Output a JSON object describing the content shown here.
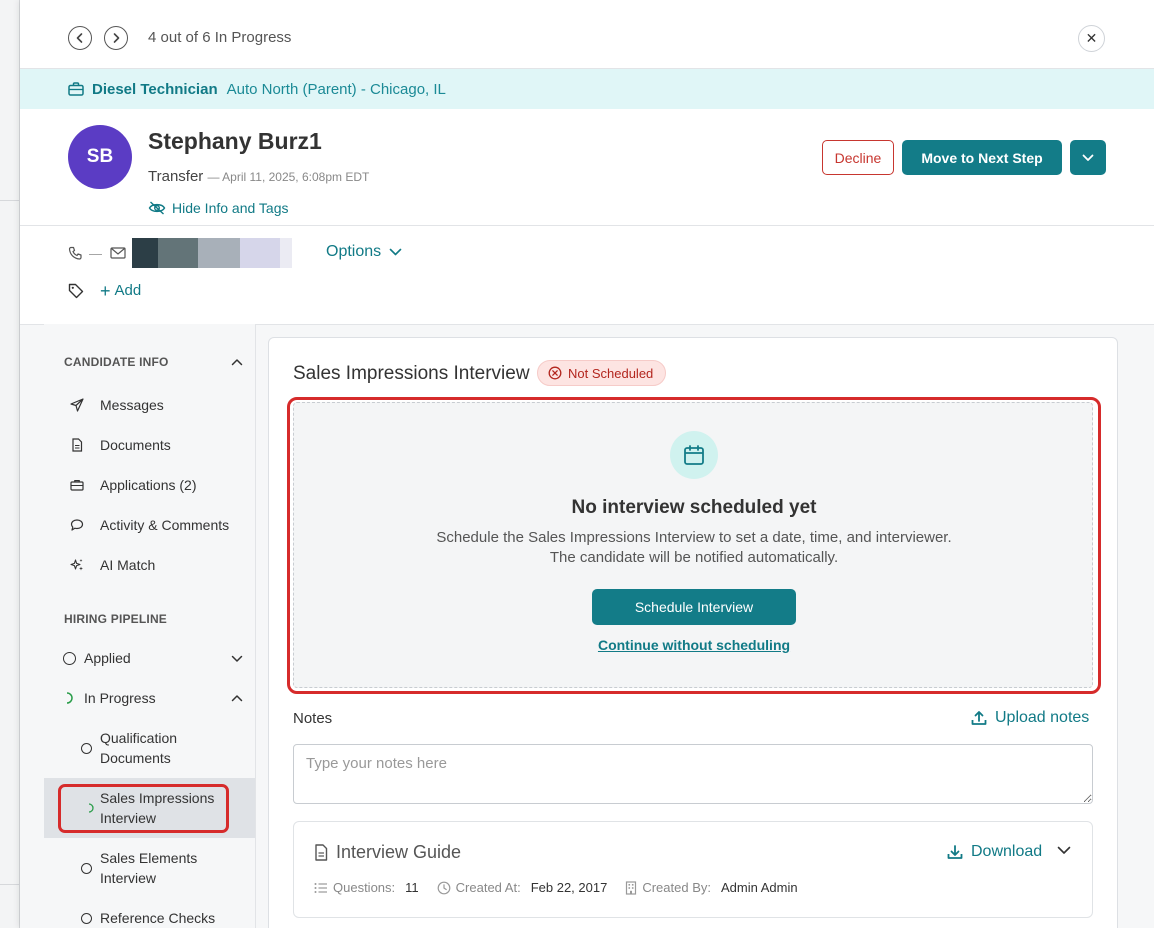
{
  "header": {
    "counter_text": "4 out of 6 In Progress",
    "close_label": "✕"
  },
  "job": {
    "title": "Diesel Technician",
    "location": "Auto North (Parent) - Chicago, IL"
  },
  "candidate": {
    "initials": "SB",
    "name": "Stephany Burz1",
    "source": "Transfer",
    "date_text": "— April 11, 2025, 6:08pm EDT",
    "hide_info_label": "Hide Info and Tags",
    "phone_value": "—",
    "options_label": "Options",
    "add_tag_label": "Add",
    "avatar_color": "#5b3cc4"
  },
  "actions": {
    "decline_label": "Decline",
    "next_step_label": "Move to Next Step"
  },
  "sidebar": {
    "candidate_info_heading": "CANDIDATE INFO",
    "candidate_info_items": [
      {
        "label": "Messages",
        "icon": "paper-plane-icon"
      },
      {
        "label": "Documents",
        "icon": "document-icon"
      },
      {
        "label": "Applications (2)",
        "icon": "briefcase-icon"
      },
      {
        "label": "Activity & Comments",
        "icon": "chat-bubble-icon"
      },
      {
        "label": "AI Match",
        "icon": "sparkle-icon"
      }
    ],
    "hiring_pipeline_heading": "HIRING PIPELINE",
    "pipeline": {
      "applied": "Applied",
      "in_progress": "In Progress",
      "steps": [
        {
          "label": "Qualification Documents",
          "status": "not-started"
        },
        {
          "label": "Sales Impressions Interview",
          "status": "in-progress",
          "selected": true
        },
        {
          "label": "Sales Elements Interview",
          "status": "not-started"
        },
        {
          "label": "Reference Checks",
          "status": "not-started"
        }
      ]
    }
  },
  "main": {
    "interview_title": "Sales Impressions Interview",
    "status_badge": "Not Scheduled",
    "empty_state": {
      "title": "No interview scheduled yet",
      "desc_line1": "Schedule the Sales Impressions Interview to set a date, time, and interviewer.",
      "desc_line2": "The candidate will be notified automatically.",
      "schedule_button": "Schedule Interview",
      "continue_link": "Continue without scheduling"
    },
    "notes": {
      "label": "Notes",
      "upload_label": "Upload notes",
      "placeholder": "Type your notes here",
      "value": ""
    },
    "guide": {
      "title": "Interview Guide",
      "download_label": "Download",
      "questions_label": "Questions:",
      "questions_value": "11",
      "created_at_label": "Created At:",
      "created_at_value": "Feb 22, 2017",
      "created_by_label": "Created By:",
      "created_by_value": "Admin Admin"
    }
  },
  "colors": {
    "brand_teal": "#137c88",
    "decline_red": "#c7362f",
    "job_bar_bg": "#e0f6f7",
    "badge_bg": "#fde4e2"
  }
}
